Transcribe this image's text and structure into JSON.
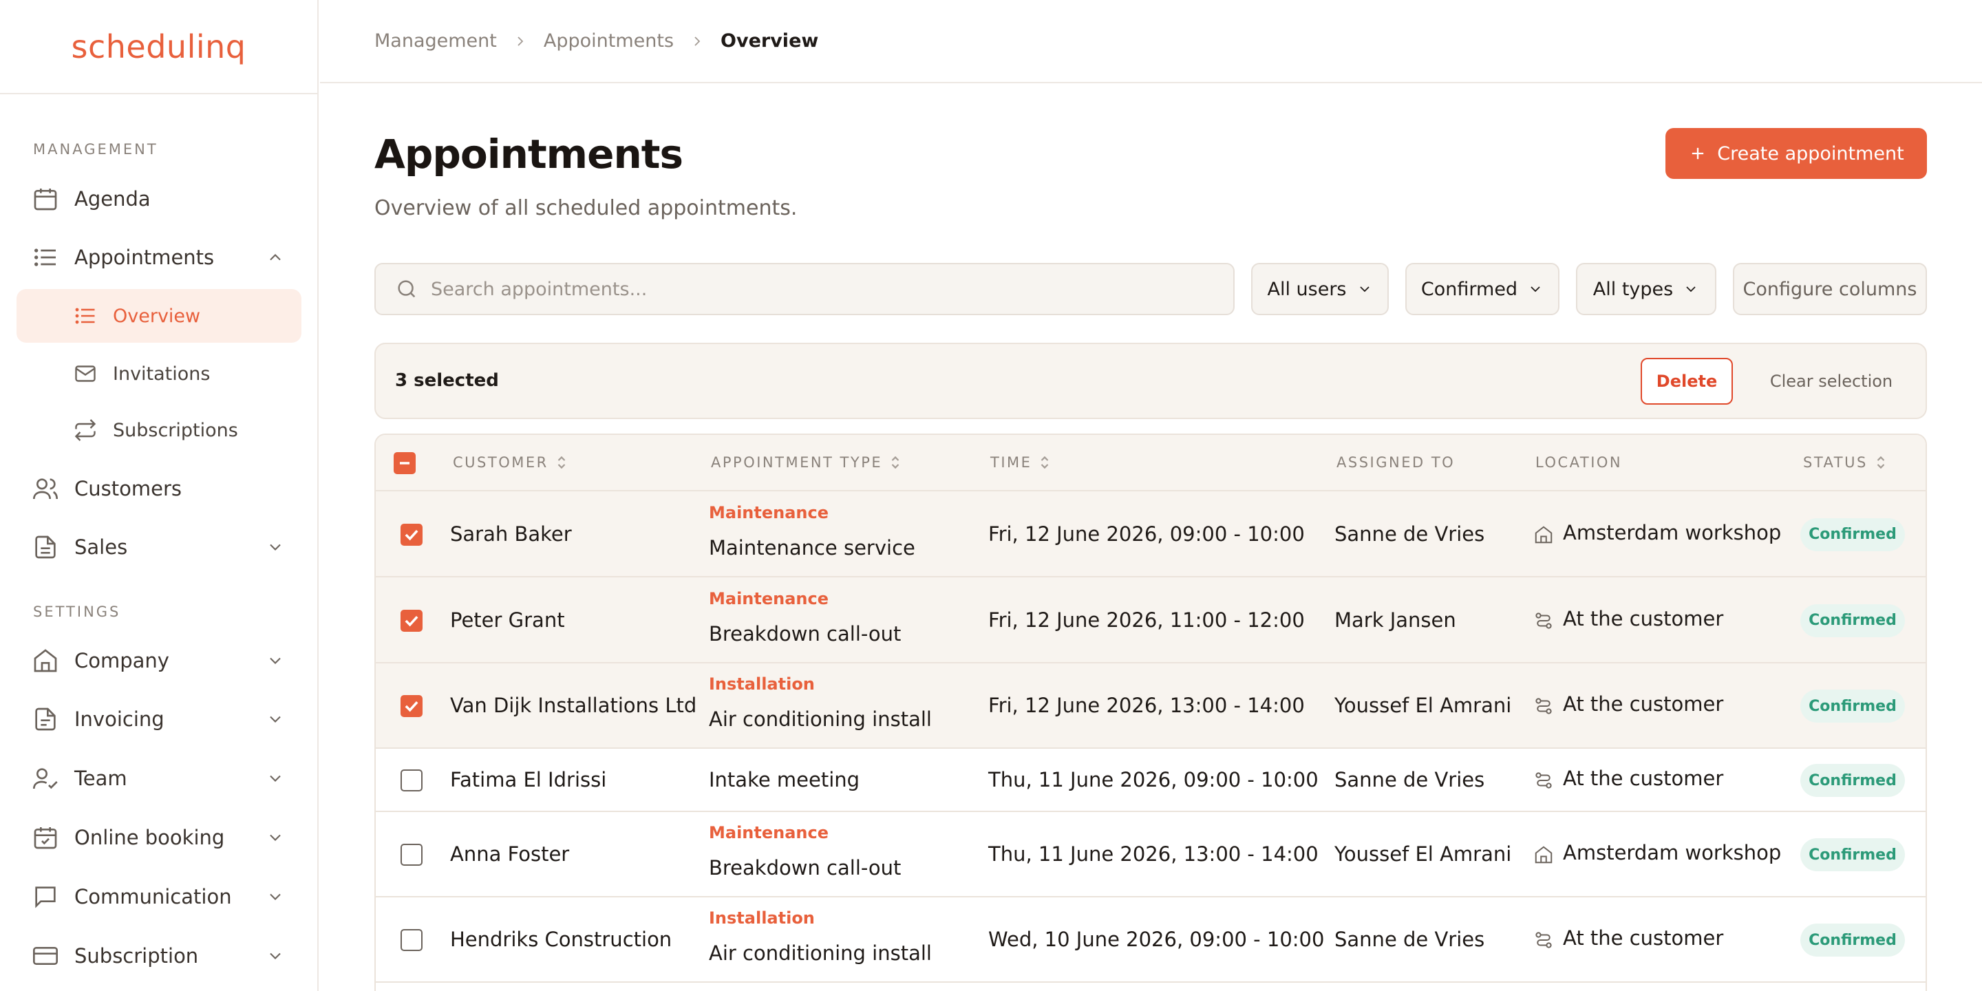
{
  "app": {
    "logo": "schedulinq",
    "accent": "#e8603c"
  },
  "sidebar": {
    "management_label": "MANAGEMENT",
    "settings_label": "SETTINGS",
    "items": {
      "agenda": "Agenda",
      "appointments": "Appointments",
      "overview": "Overview",
      "invitations": "Invitations",
      "subscriptions": "Subscriptions",
      "customers": "Customers",
      "sales": "Sales",
      "company": "Company",
      "invoicing": "Invoicing",
      "team": "Team",
      "online_booking": "Online booking",
      "communication": "Communication",
      "subscription": "Subscription"
    }
  },
  "breadcrumb": [
    "Management",
    "Appointments",
    "Overview"
  ],
  "header": {
    "title": "Appointments",
    "subtitle": "Overview of all scheduled appointments.",
    "create_label": "Create appointment"
  },
  "filters": {
    "search_placeholder": "Search appointments...",
    "users": "All users",
    "status": "Confirmed",
    "types": "All types",
    "configure": "Configure columns"
  },
  "selection": {
    "count": "3 selected",
    "delete": "Delete",
    "clear": "Clear selection"
  },
  "table": {
    "columns": {
      "customer": "CUSTOMER",
      "type": "APPOINTMENT TYPE",
      "time": "TIME",
      "assigned": "ASSIGNED TO",
      "location": "LOCATION",
      "status": "STATUS"
    },
    "rows": [
      {
        "selected": true,
        "customer": "Sarah Baker",
        "category": "Maintenance",
        "type": "Maintenance service",
        "time": "Fri, 12 June 2026, 09:00 - 10:00",
        "assigned": "Sanne de Vries",
        "location_icon": "building-icon",
        "location": "Amsterdam workshop",
        "status": "Confirmed"
      },
      {
        "selected": true,
        "customer": "Peter Grant",
        "category": "Maintenance",
        "type": "Breakdown call-out",
        "time": "Fri, 12 June 2026, 11:00 - 12:00",
        "assigned": "Mark Jansen",
        "location_icon": "route-icon",
        "location": "At the customer",
        "status": "Confirmed"
      },
      {
        "selected": true,
        "customer": "Van Dijk Installations Ltd",
        "category": "Installation",
        "type": "Air conditioning install",
        "time": "Fri, 12 June 2026, 13:00 - 14:00",
        "assigned": "Youssef El Amrani",
        "location_icon": "route-icon",
        "location": "At the customer",
        "status": "Confirmed"
      },
      {
        "selected": false,
        "customer": "Fatima El Idrissi",
        "category": "",
        "type": "Intake meeting",
        "time": "Thu, 11 June 2026, 09:00 - 10:00",
        "assigned": "Sanne de Vries",
        "location_icon": "route-icon",
        "location": "At the customer",
        "status": "Confirmed"
      },
      {
        "selected": false,
        "customer": "Anna Foster",
        "category": "Maintenance",
        "type": "Breakdown call-out",
        "time": "Thu, 11 June 2026, 13:00 - 14:00",
        "assigned": "Youssef El Amrani",
        "location_icon": "building-icon",
        "location": "Amsterdam workshop",
        "status": "Confirmed"
      },
      {
        "selected": false,
        "customer": "Hendriks Construction",
        "category": "Installation",
        "type": "Air conditioning install",
        "time": "Wed, 10 June 2026, 09:00 - 10:00",
        "assigned": "Sanne de Vries",
        "location_icon": "route-icon",
        "location": "At the customer",
        "status": "Confirmed"
      }
    ]
  }
}
